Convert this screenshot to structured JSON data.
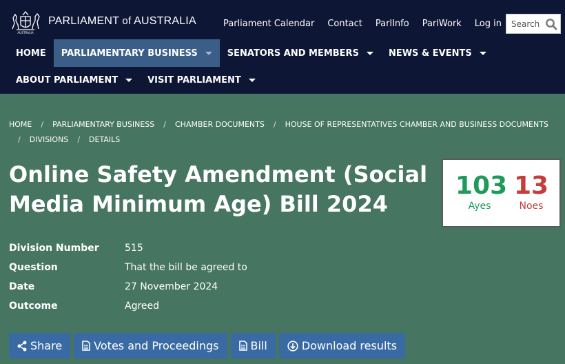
{
  "header": {
    "site_name_prefix": "PARLIAMENT",
    "site_name_of": "of",
    "site_name_suffix": "AUSTRALIA",
    "crest_text": "AUSTRALIA",
    "utility_links": [
      "Parliament Calendar",
      "Contact",
      "ParlInfo",
      "ParlWork",
      "Log in"
    ],
    "search": {
      "placeholder": "Search",
      "icon": "search-icon"
    }
  },
  "main_nav": {
    "row1": [
      {
        "label": "HOME",
        "dropdown": false,
        "active": false
      },
      {
        "label": "PARLIAMENTARY BUSINESS",
        "dropdown": true,
        "active": true
      },
      {
        "label": "SENATORS AND MEMBERS",
        "dropdown": true,
        "active": false
      },
      {
        "label": "NEWS & EVENTS",
        "dropdown": true,
        "active": false
      }
    ],
    "row2": [
      {
        "label": "ABOUT PARLIAMENT",
        "dropdown": true,
        "active": false
      },
      {
        "label": "VISIT PARLIAMENT",
        "dropdown": true,
        "active": false
      }
    ]
  },
  "breadcrumb": {
    "separator": "/",
    "items": [
      "HOME",
      "PARLIAMENTARY BUSINESS",
      "CHAMBER DOCUMENTS",
      "HOUSE OF REPRESENTATIVES CHAMBER AND BUSINESS DOCUMENTS",
      "DIVISIONS",
      "DETAILS"
    ]
  },
  "page": {
    "title": "Online Safety Amendment (Social Media Minimum Age) Bill 2024"
  },
  "vote": {
    "ayes": {
      "count": "103",
      "label": "Ayes",
      "color": "#1f9a5b"
    },
    "noes": {
      "count": "13",
      "label": "Noes",
      "color": "#c43c3c"
    }
  },
  "details": [
    {
      "label": "Division Number",
      "value": "515"
    },
    {
      "label": "Question",
      "value": "That the bill be agreed to"
    },
    {
      "label": "Date",
      "value": "27 November 2024"
    },
    {
      "label": "Outcome",
      "value": "Agreed"
    }
  ],
  "actions": [
    {
      "label": "Share",
      "icon": "share-icon"
    },
    {
      "label": "Votes and Proceedings",
      "icon": "document-icon"
    },
    {
      "label": "Bill",
      "icon": "document-icon"
    },
    {
      "label": "Download results",
      "icon": "download-icon"
    }
  ],
  "colors": {
    "header_bg": "#0d1635",
    "nav_active_bg": "#3a5e88",
    "content_bg": "#467562",
    "button_bg": "#3a6aa4"
  }
}
